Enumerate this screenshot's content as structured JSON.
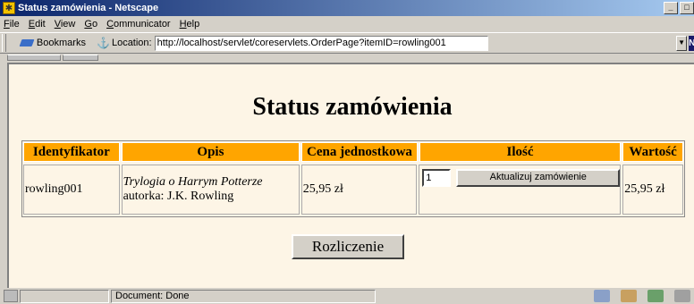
{
  "window": {
    "title": "Status zamówienia - Netscape"
  },
  "menu": [
    "File",
    "Edit",
    "View",
    "Go",
    "Communicator",
    "Help"
  ],
  "toolbar": {
    "bookmarks_label": "Bookmarks",
    "location_label": "Location:",
    "url": "http://localhost/servlet/coreservlets.OrderPage?itemID=rowling001"
  },
  "page": {
    "title": "Status zamówienia",
    "table": {
      "headers": [
        "Identyfikator",
        "Opis",
        "Cena jednostkowa",
        "Ilość",
        "Wartość"
      ],
      "rows": [
        {
          "id": "rowling001",
          "desc_title": "Trylogia o Harrym Potterze",
          "desc_author": "autorka: J.K. Rowling",
          "price": "25,95 zł",
          "qty": "1",
          "update_label": "Aktualizuj zamówienie",
          "total": "25,95 zł"
        }
      ]
    },
    "checkout_label": "Rozliczenie"
  },
  "status": {
    "text": "Document: Done"
  },
  "colors": {
    "header_bg": "#ffa500",
    "page_bg": "#fdf5e6",
    "titlebar": "#0a246a"
  }
}
